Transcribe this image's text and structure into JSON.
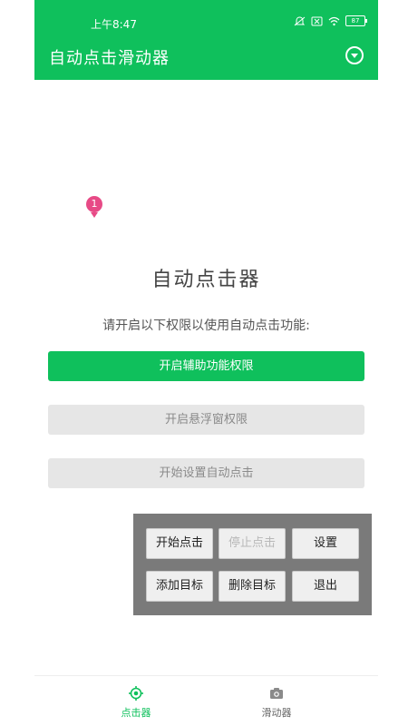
{
  "statusbar": {
    "time": "上午8:47",
    "battery": "87"
  },
  "appbar": {
    "title": "自动点击滑动器"
  },
  "pin": {
    "label": "1"
  },
  "main": {
    "heading": "自动点击器",
    "subtitle": "请开启以下权限以使用自动点击功能:",
    "buttons": {
      "accessibility": "开启辅助功能权限",
      "overlay": "开启悬浮窗权限",
      "setup": "开始设置自动点击"
    }
  },
  "panel": {
    "start": "开始点击",
    "stop": "停止点击",
    "settings": "设置",
    "add_target": "添加目标",
    "delete_target": "删除目标",
    "exit": "退出"
  },
  "bottomnav": {
    "items": [
      {
        "label": "点击器",
        "icon": "crosshair-icon"
      },
      {
        "label": "滑动器",
        "icon": "camera-icon"
      }
    ]
  },
  "colors": {
    "brand_green": "#0fc05c",
    "pin_pink": "#e74a86",
    "panel_gray": "#7a7a7a",
    "disabled_gray": "#e6e6e6"
  }
}
